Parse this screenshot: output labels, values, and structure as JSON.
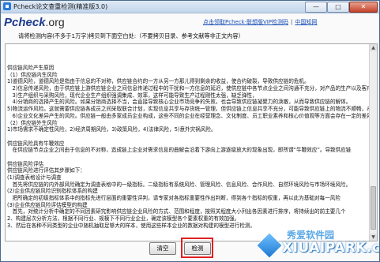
{
  "window": {
    "title": "Pcheck论文查重检测(精准版3.0)"
  },
  "header": {
    "logo_main": "Pcheck",
    "logo_suffix": ".org",
    "links": [
      "点击领取Pcheck·联想版VIP检测码",
      "中国知网"
    ]
  },
  "instruction": "请将检测内容(不多于1万字)拷贝到下面空白处:（不要拷贝目录、参考文献等非正文内容）",
  "document_lines": [
    "供应链风险产生原因",
    "（1）供应链内生风险",
    "1)道德风险，道德风险是指由于信息的不对称，供应链合约的一方从另一方那儿得到剩余的收益，使合约破裂，导致供应链的危机。",
    "　2)信息传递风险，由于供应链上游供应链企业之间信息传递过程中的干扰和一方信息的延迟，使供应链中各节点企业之间沟通不充分，对产品的生产以及客户的需求",
    "　3)生产组织与采购风险，现代企业生产组织强调集成、效率，这样可能导致生产过程刚性太强，缺乏弹性，",
    "　4)分销商的选择产生的风险。如果分销商选择不当，会直接导致核心企业市场竞争的失败，也会导致供应链凝聚力的涣散，从而导致供应链的解体。",
    "5)物流运作风险。这就需要供应链各成员之间采取联合计划，实现信息共享与存货统一管理，但供应链上信息共享不充分，可能导致供应链上的物流不顺畅，从而造成断货或存货积压的局面。",
    "　6)企业文化差异产生的风险。供应链一般由多家成员企业构成，这些不同的企业在经营理念、文化制度、员工职业素养和核心价值观等方面会存在一定的差异。",
    "（2）供应链外生风险",
    "1)市场需求不确定性风险，2)经济周期风险，3)政策风险，4)法律风险，5)意外灾祸风险。",
    "",
    "供应链风险具有牛鞭效应",
    "　在供应链节点企业之间由于信息的不对称，造成链上企业对需求信息的曲解会沿着下游向上游逐级放大的现象出现，即所谓“牛鞭效应”。导致供应链",
    "",
    "供应链风险评估",
    "供应链风险进行评估其步骤如下：",
    "(1)调查表格设计与调查",
    "　首先将供应链的内外部风险确定为调查表格中的一级指标。二级指标有系统风险、管理风险、信息风险、合作风险、自然环境风险与市场环境风险。",
    "(2)企业供应链风险识别指标体系的构建",
    "　把所确定的初级指标体系中的指标先进行层面的重要性评判，请专家对各指标重要性作出判断，得到各个指标的权重，再以此为基础对每一风险",
    "(3)企业供应链风险评估模型的构建",
    "　首先，对统计分析中确定的不同因素研究影响供应链企业风险的方式、范围和程度，按照关程度大小列出各因素进行排序，将持续出的前主要几个",
    "2、构建层次分析方法，根据不同行业、规模下不同行业企业，确定该模型各个要素权重的有效加强。",
    "3、然后在各种不同类型的企业中随机抽取足够大的样本，使用这些样本企业的数据对构建的模型进行检测。"
  ],
  "buttons": {
    "clear": "清空",
    "detect": "检测"
  },
  "watermark": {
    "top": "秀爱软件园",
    "bottom": "XIUAIPARK.com"
  }
}
